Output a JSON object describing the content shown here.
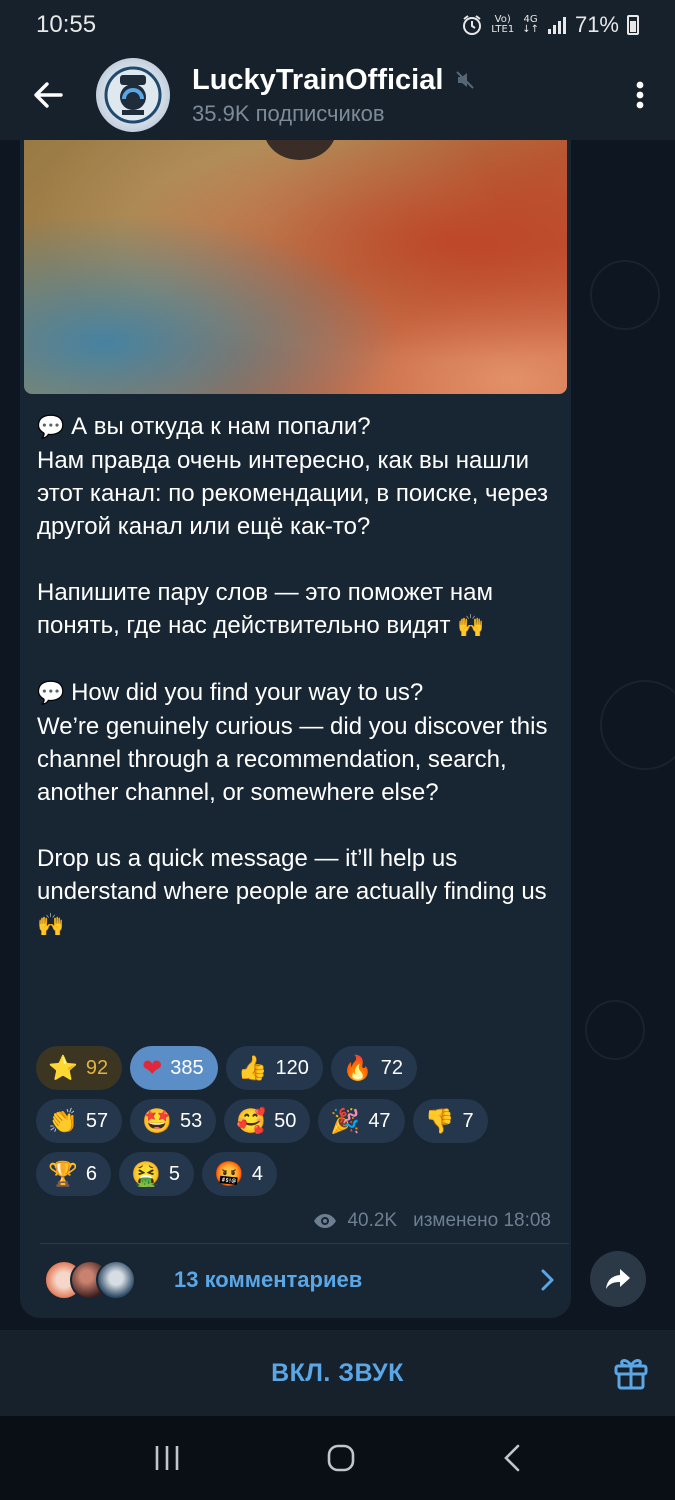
{
  "status_bar": {
    "time": "10:55",
    "net_top": "Vo)",
    "net_bottom": "LTE1",
    "net_type": "4G",
    "battery": "71%"
  },
  "header": {
    "channel_name": "LuckyTrainOfficial",
    "subscribers": "35.9K подписчиков",
    "icons": [
      "back-arrow-icon",
      "mute-icon",
      "more-vertical-icon"
    ]
  },
  "message": {
    "paragraphs": [
      {
        "emoji": "💬",
        "text": " А вы откуда к нам попали?\nНам правда очень интересно, как вы нашли этот канал: по рекомендации, в поиске, через другой канал или ещё как-то?"
      },
      {
        "emoji": "",
        "text": "Напишите пару слов — это поможет нам понять, где нас действительно видят",
        "trailing_emoji": "🙌"
      },
      {
        "emoji": "💬",
        "text": " How did you find your way to us?\nWe’re genuinely curious — did you discover this channel through a recommendation, search, another channel, or somewhere else?"
      },
      {
        "emoji": "",
        "text": "Drop us a quick message — it’ll help us understand where people are actually finding us",
        "trailing_emoji": "🙌"
      }
    ],
    "reactions": [
      [
        {
          "emoji": "⭐",
          "count": "92",
          "style": "star"
        },
        {
          "emoji": "❤",
          "count": "385",
          "style": "heart"
        },
        {
          "emoji": "👍",
          "count": "120"
        },
        {
          "emoji": "🔥",
          "count": "72"
        }
      ],
      [
        {
          "emoji": "👏",
          "count": "57"
        },
        {
          "emoji": "🤩",
          "count": "53"
        },
        {
          "emoji": "🥰",
          "count": "50"
        },
        {
          "emoji": "🎉",
          "count": "47"
        },
        {
          "emoji": "👎",
          "count": "7"
        }
      ],
      [
        {
          "emoji": "🏆",
          "count": "6"
        },
        {
          "emoji": "🤮",
          "count": "5"
        },
        {
          "emoji": "🤬",
          "count": "4"
        }
      ]
    ],
    "views": "40.2K",
    "edited_time": "изменено 18:08",
    "comments_label": "13 комментариев"
  },
  "bottom": {
    "unmute_label": "ВКЛ. ЗВУК"
  },
  "colors": {
    "accent": "#5ba6e5",
    "bubble": "#182533",
    "bar": "#17212b",
    "heart_pill": "#5b8ec6",
    "star_pill": "#3b3522"
  }
}
